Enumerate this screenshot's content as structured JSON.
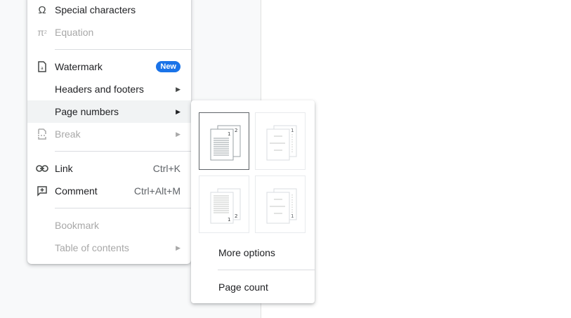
{
  "insert_menu": {
    "items": [
      {
        "label": "Special characters",
        "icon": "omega-icon"
      },
      {
        "label": "Equation",
        "icon": "pi-icon",
        "disabled": true
      },
      {
        "label": "Watermark",
        "icon": "watermark-icon",
        "badge": "New"
      },
      {
        "label": "Headers and footers"
      },
      {
        "label": "Page numbers",
        "highlighted": true
      },
      {
        "label": "Break",
        "icon": "break-icon",
        "disabled": true
      },
      {
        "label": "Link",
        "icon": "link-icon",
        "shortcut": "Ctrl+K"
      },
      {
        "label": "Comment",
        "icon": "comment-add-icon",
        "shortcut": "Ctrl+Alt+M"
      },
      {
        "label": "Bookmark",
        "disabled": true
      },
      {
        "label": "Table of contents",
        "disabled": true
      }
    ]
  },
  "page_numbers_submenu": {
    "options": [
      {
        "position": "top-right, including first page",
        "selected": true,
        "numbers": [
          "1",
          "2"
        ]
      },
      {
        "position": "top-right, skip first page",
        "numbers": [
          "1"
        ]
      },
      {
        "position": "bottom-right, including first page",
        "numbers": [
          "1",
          "2"
        ]
      },
      {
        "position": "bottom-right, skip first page",
        "numbers": [
          "1"
        ]
      }
    ],
    "more_options": "More options",
    "page_count": "Page count"
  },
  "colors": {
    "badge": "#1a73e8",
    "hover": "#f1f3f4",
    "disabled_text": "#a8a8a8"
  }
}
